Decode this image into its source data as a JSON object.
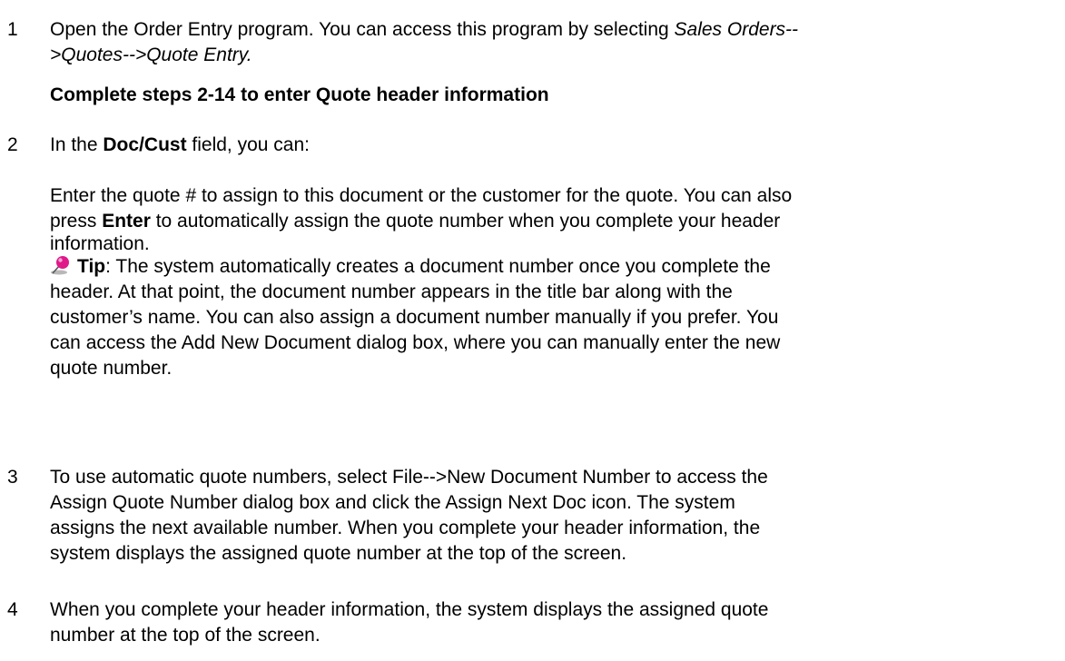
{
  "steps": [
    {
      "number": "1",
      "text_a": "Open the Order Entry program. You can access this program by selecting ",
      "italic_a": "Sales Orders--",
      "italic_b": ">Quotes-->Quote Entry.",
      "subheading": "Complete steps 2-14 to enter Quote header information"
    },
    {
      "number": "2",
      "intro_a": "In the ",
      "intro_bold": "Doc/Cust",
      "intro_b": " field, you can:",
      "line1": "Enter the quote # to assign to this document or the customer for the quote. You can also",
      "line2_a": "press ",
      "line2_bold": "Enter",
      "line2_b": " to automatically assign the quote number when you complete your header",
      "line3": "information.",
      "tip_icon": "pushpin-icon",
      "tip_label": "Tip",
      "tip_line1": ": The system automatically creates a document number once you complete the",
      "tip_line2": "header. At that point, the document number appears in the title bar along with the",
      "tip_line3": "customer’s name. You can also assign a document number manually if you prefer. You",
      "tip_line4": "can access the Add New Document dialog box, where you can manually enter the new",
      "tip_line5": "quote number."
    },
    {
      "number": "3",
      "line1": "To use automatic quote numbers, select File-->New Document Number to access the",
      "line2": "Assign Quote Number dialog box and click the Assign Next Doc icon. The system",
      "line3": "assigns the next available number. When you complete your header information, the",
      "line4": "system displays the assigned quote number at the top of the screen."
    },
    {
      "number": "4",
      "line1": "When you complete your header information, the system displays the assigned quote",
      "line2": "number at the top of the screen."
    }
  ],
  "colors": {
    "pin_head": "#e0198a",
    "pin_shadow": "#9a9a9a"
  }
}
